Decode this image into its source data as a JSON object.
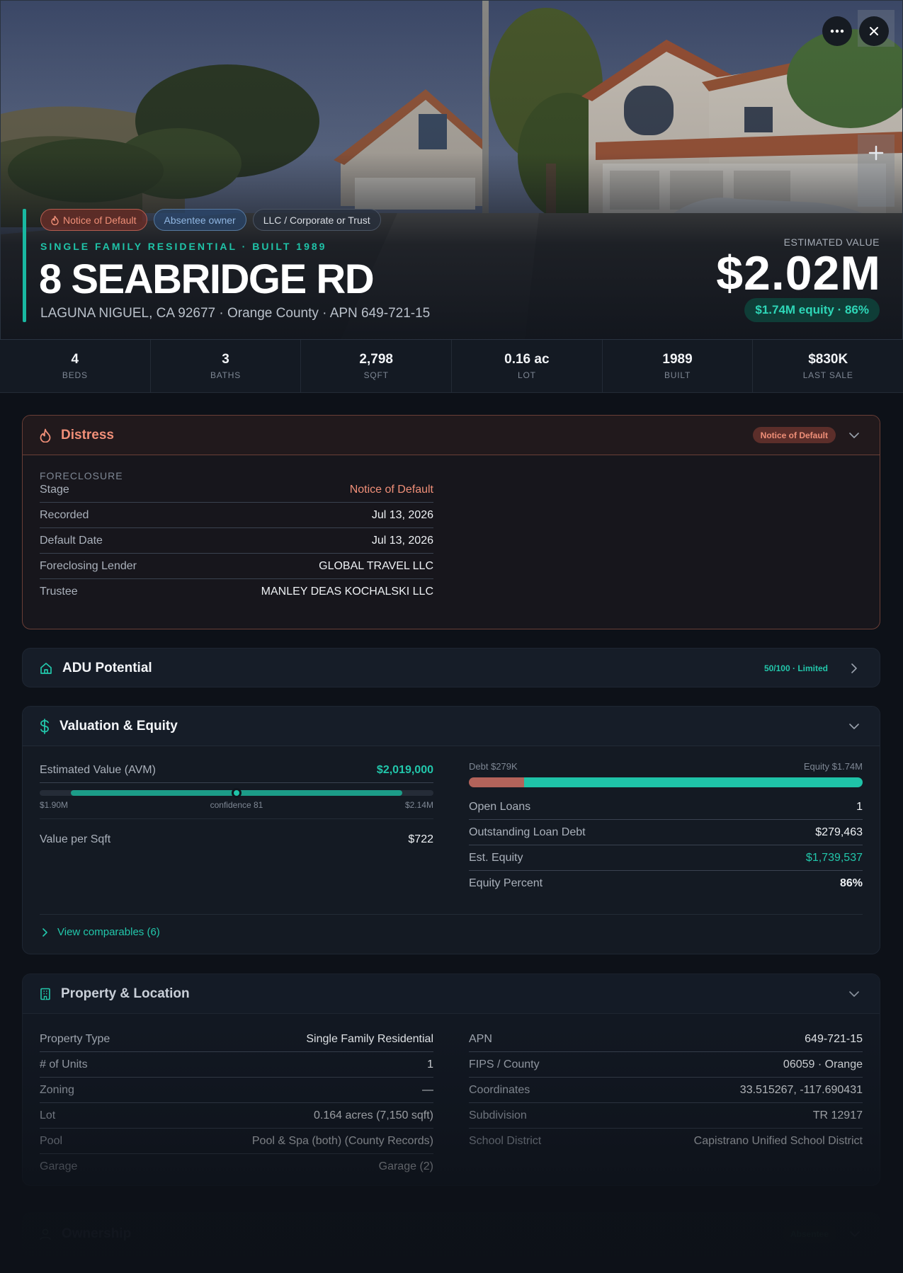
{
  "hero": {
    "tags": {
      "distress": "Notice of Default",
      "owner": "Absentee owner",
      "entity": "LLC / Corporate or Trust"
    },
    "subtitle": "SINGLE FAMILY RESIDENTIAL · BUILT 1989",
    "address": "8 SEABRIDGE RD",
    "location": "LAGUNA NIGUEL, CA 92677 · Orange County · APN 649-721-15",
    "estimated_label": "ESTIMATED VALUE",
    "estimated_value": "$2.02M",
    "equity_pill": "$1.74M equity · 86%",
    "more_icon": "more-horizontal-icon",
    "close_icon": "close-icon",
    "zoom_in_icon": "plus-icon"
  },
  "stats": [
    {
      "value": "4",
      "label": "BEDS"
    },
    {
      "value": "3",
      "label": "BATHS"
    },
    {
      "value": "2,798",
      "label": "SQFT"
    },
    {
      "value": "0.16 ac",
      "label": "LOT"
    },
    {
      "value": "1989",
      "label": "BUILT"
    },
    {
      "value": "$830K",
      "label": "LAST SALE"
    }
  ],
  "distress": {
    "title": "Distress",
    "icon": "flame-icon",
    "badge": "Notice of Default",
    "section": "FORECLOSURE",
    "rows": [
      {
        "key": "Stage",
        "value": "Notice of Default"
      },
      {
        "key": "Recorded",
        "value": "Jul 13, 2026"
      },
      {
        "key": "Default Date",
        "value": "Jul 13, 2026"
      },
      {
        "key": "Foreclosing Lender",
        "value": "GLOBAL TRAVEL LLC"
      },
      {
        "key": "Trustee",
        "value": "MANLEY DEAS KOCHALSKI LLC"
      }
    ]
  },
  "adu": {
    "title": "ADU Potential",
    "icon": "home-icon",
    "badge": "50/100 · Limited"
  },
  "valuation": {
    "title": "Valuation & Equity",
    "icon": "dollar-icon",
    "avm_label": "Estimated Value (AVM)",
    "avm_value": "$2,019,000",
    "range_low": "$1.90M",
    "confidence": "confidence 81",
    "range_high": "$2.14M",
    "avm_position": 0.5,
    "per_sqft_label": "Value per Sqft",
    "per_sqft_value": "$722",
    "debt_label": "Debt $279K",
    "equity_label": "Equity $1.74M",
    "debt_fraction": 0.14,
    "rows": [
      {
        "key": "Open Loans",
        "value": "1"
      },
      {
        "key": "Outstanding Loan Debt",
        "value": "$279,463"
      },
      {
        "key": "Est. Equity",
        "value": "$1,739,537"
      },
      {
        "key": "Equity Percent",
        "value": "86%"
      }
    ],
    "comparables": "View comparables (6)"
  },
  "property": {
    "title": "Property & Location",
    "icon": "building-icon",
    "left_rows": [
      {
        "key": "Property Type",
        "value": "Single Family Residential"
      },
      {
        "key": "# of Units",
        "value": "1"
      },
      {
        "key": "Zoning",
        "value": "—"
      },
      {
        "key": "Lot",
        "value": "0.164 acres (7,150 sqft)"
      },
      {
        "key": "Pool",
        "value": "Pool & Spa (both) (County Records)"
      },
      {
        "key": "Garage",
        "value": "Garage (2)"
      }
    ],
    "right_rows": [
      {
        "key": "APN",
        "value": "649-721-15"
      },
      {
        "key": "FIPS / County",
        "value": "06059 · Orange"
      },
      {
        "key": "Coordinates",
        "value": "33.515267, -117.690431"
      },
      {
        "key": "Subdivision",
        "value": "TR 12917"
      },
      {
        "key": "School District",
        "value": "Capistrano Unified School District"
      }
    ]
  },
  "ownership": {
    "title": "Ownership",
    "icon": "user-icon",
    "badge": "Absentee"
  },
  "colors": {
    "accent": "#1fc3a8",
    "distress": "#f08f78",
    "background": "#0d1118",
    "debt": "#b3635a"
  }
}
